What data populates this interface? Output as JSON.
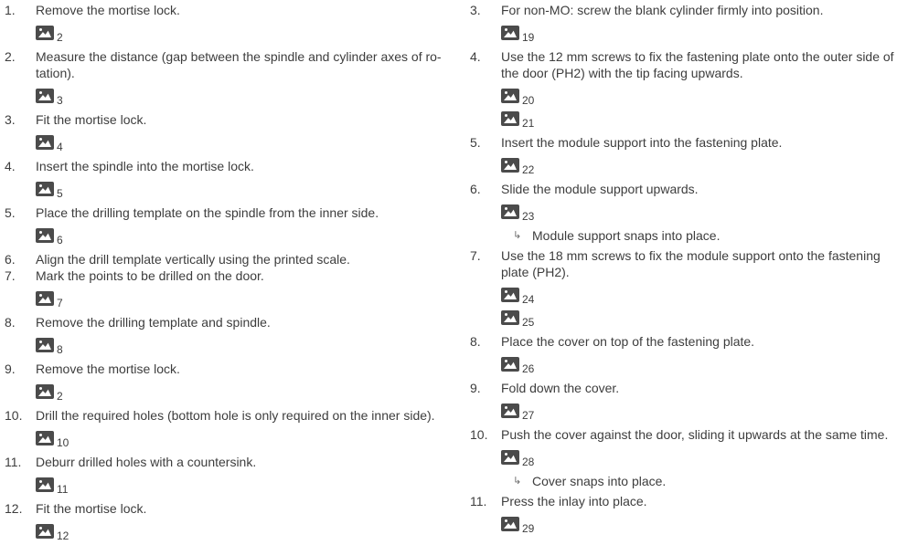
{
  "left_column": {
    "steps": [
      {
        "number": "1.",
        "lines": [
          "Remove the mortise lock."
        ],
        "figures": [
          "2"
        ]
      },
      {
        "number": "2.",
        "lines": [
          "Measure the distance (gap between the spindle and cylinder axes of ro-",
          "tation)."
        ],
        "figures": [
          "3"
        ]
      },
      {
        "number": "3.",
        "lines": [
          "Fit the mortise lock."
        ],
        "figures": [
          "4"
        ]
      },
      {
        "number": "4.",
        "lines": [
          "Insert the spindle into the mortise lock."
        ],
        "figures": [
          "5"
        ]
      },
      {
        "number": "5.",
        "lines": [
          "Place the drilling template on the spindle from the inner side."
        ],
        "figures": [
          "6"
        ]
      },
      {
        "number": "6.",
        "lines": [
          "Align the drill template vertically using the printed scale."
        ],
        "figures": []
      },
      {
        "number": "7.",
        "lines": [
          "Mark the points to be drilled on the door."
        ],
        "figures": [
          "7"
        ]
      },
      {
        "number": "8.",
        "lines": [
          "Remove the drilling template and spindle."
        ],
        "figures": [
          "8"
        ]
      },
      {
        "number": "9.",
        "lines": [
          "Remove the mortise lock."
        ],
        "figures": [
          "2"
        ]
      },
      {
        "number": "10.",
        "lines": [
          "Drill the required holes (bottom hole is only required on the inner side)."
        ],
        "figures": [
          "10"
        ]
      },
      {
        "number": "11.",
        "lines": [
          "Deburr drilled holes with a countersink."
        ],
        "figures": [
          "11"
        ]
      },
      {
        "number": "12.",
        "lines": [
          "Fit the mortise lock."
        ],
        "figures": [
          "12"
        ]
      }
    ]
  },
  "right_column": {
    "steps": [
      {
        "number": "3.",
        "lines": [
          "For non-MO: screw the blank cylinder firmly into position."
        ],
        "figures": [
          "19"
        ]
      },
      {
        "number": "4.",
        "lines": [
          "Use the 12 mm screws to fix the fastening plate onto the outer side of",
          "the door (PH2) with the tip facing upwards."
        ],
        "figures": [
          "20",
          "21"
        ]
      },
      {
        "number": "5.",
        "lines": [
          "Insert the module support into the fastening plate."
        ],
        "figures": [
          "22"
        ]
      },
      {
        "number": "6.",
        "lines": [
          "Slide the module support upwards."
        ],
        "figures": [
          "23"
        ],
        "result": "Module support snaps into place."
      },
      {
        "number": "7.",
        "lines": [
          "Use the 18 mm screws to fix the module support onto the fastening",
          "plate (PH2)."
        ],
        "figures": [
          "24",
          "25"
        ]
      },
      {
        "number": "8.",
        "lines": [
          "Place the cover on top of the fastening plate."
        ],
        "figures": [
          "26"
        ]
      },
      {
        "number": "9.",
        "lines": [
          "Fold down the cover."
        ],
        "figures": [
          "27"
        ]
      },
      {
        "number": "10.",
        "lines": [
          "Push the cover against the door, sliding it upwards at the same time."
        ],
        "figures": [
          "28"
        ],
        "result": "Cover snaps into place."
      },
      {
        "number": "11.",
        "lines": [
          "Press the inlay into place."
        ],
        "figures": [
          "29"
        ]
      }
    ]
  },
  "result_marker": "↳",
  "figure_icon": "image-placeholder-icon",
  "colors": {
    "text": "#3d3d3d",
    "icon_bg": "#4b4b4b",
    "icon_fg": "#ffffff",
    "marker": "#6b6b6b"
  }
}
